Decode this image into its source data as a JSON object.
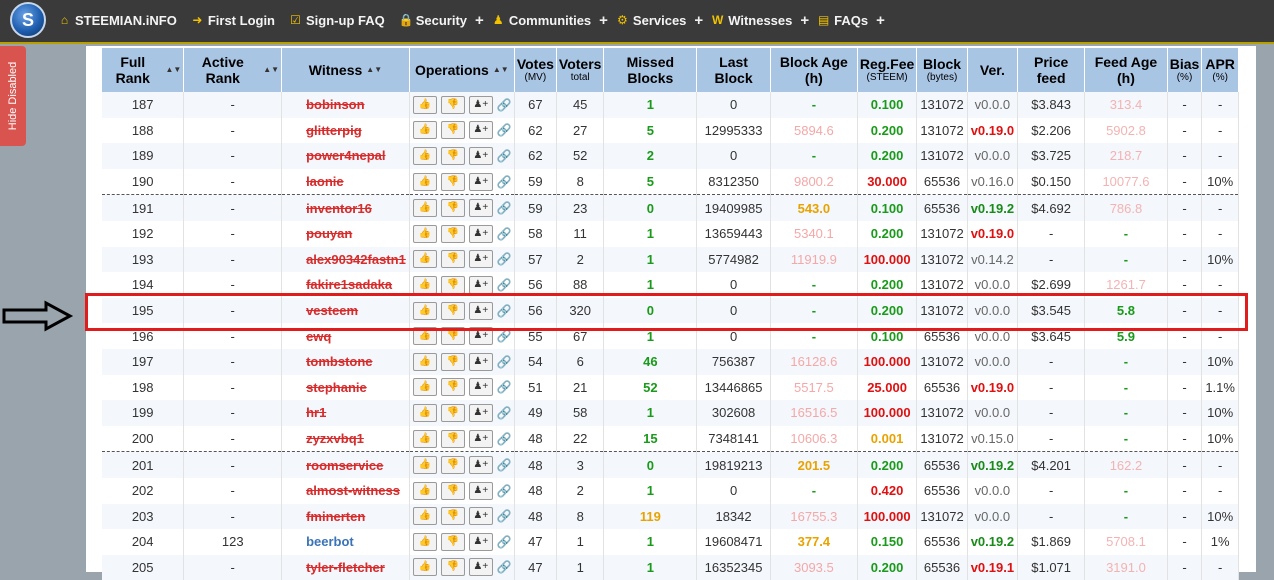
{
  "nav": {
    "brand": "STEEMIAN.iNFO",
    "items": [
      {
        "label": "First Login",
        "icon": "sign-in-icon",
        "plus": false
      },
      {
        "label": "Sign-up FAQ",
        "icon": "checkbox-icon",
        "plus": false
      },
      {
        "label": "Security",
        "icon": "lock-icon",
        "plus": true
      },
      {
        "label": "Communities",
        "icon": "users-icon",
        "plus": true
      },
      {
        "label": "Services",
        "icon": "cogs-icon",
        "plus": true
      },
      {
        "label": "Witnesses",
        "icon": "wordpress-icon",
        "plus": true
      },
      {
        "label": "FAQs",
        "icon": "document-icon",
        "plus": true
      }
    ]
  },
  "side_tab": {
    "label": "Hide Disabled"
  },
  "table": {
    "headers": [
      {
        "label": "Full Rank",
        "sub": ""
      },
      {
        "label": "Active Rank",
        "sub": ""
      },
      {
        "label": "Witness",
        "sub": ""
      },
      {
        "label": "Operations",
        "sub": ""
      },
      {
        "label": "Votes",
        "sub": "(MV)"
      },
      {
        "label": "Voters",
        "sub": "total"
      },
      {
        "label": "Missed Blocks",
        "sub": ""
      },
      {
        "label": "Last Block",
        "sub": ""
      },
      {
        "label": "Block Age (h)",
        "sub": ""
      },
      {
        "label": "Reg.Fee",
        "sub": "(STEEM)"
      },
      {
        "label": "Block",
        "sub": "(bytes)"
      },
      {
        "label": "Ver.",
        "sub": ""
      },
      {
        "label": "Price feed",
        "sub": ""
      },
      {
        "label": "Feed Age (h)",
        "sub": ""
      },
      {
        "label": "Bias",
        "sub": "(%)"
      },
      {
        "label": "APR",
        "sub": "(%)"
      }
    ],
    "rows": [
      {
        "rank": "187",
        "active": "-",
        "name": "bobinson",
        "link": "ok",
        "votes": "67",
        "voters": "45",
        "missed": "1",
        "mc": "g",
        "last": "0",
        "age": "-",
        "ac": "g",
        "fee": "0.100",
        "fc": "g",
        "block": "131072",
        "ver": "v0.0.0",
        "vc": "ver",
        "price": "$3.843",
        "feed": "313.4",
        "fdc": "pinkl",
        "bias": "-",
        "apr": "-",
        "group": false
      },
      {
        "rank": "188",
        "active": "-",
        "name": "glitterpig",
        "link": "ok",
        "votes": "62",
        "voters": "27",
        "missed": "5",
        "mc": "g",
        "last": "12995333",
        "age": "5894.6",
        "ac": "pink",
        "fee": "0.200",
        "fc": "g",
        "block": "131072",
        "ver": "v0.19.0",
        "vc": "verr",
        "price": "$2.206",
        "feed": "5902.8",
        "fdc": "pinkl",
        "bias": "-",
        "apr": "-",
        "group": false
      },
      {
        "rank": "189",
        "active": "-",
        "name": "power4nepal",
        "link": "ok",
        "votes": "62",
        "voters": "52",
        "missed": "2",
        "mc": "g",
        "last": "0",
        "age": "-",
        "ac": "g",
        "fee": "0.200",
        "fc": "g",
        "block": "131072",
        "ver": "v0.0.0",
        "vc": "ver",
        "price": "$3.725",
        "feed": "218.7",
        "fdc": "pinkl",
        "bias": "-",
        "apr": "-",
        "group": false
      },
      {
        "rank": "190",
        "active": "-",
        "name": "laonie",
        "link": "ok",
        "votes": "59",
        "voters": "8",
        "missed": "5",
        "mc": "g",
        "last": "8312350",
        "age": "9800.2",
        "ac": "pink",
        "fee": "30.000",
        "fc": "r",
        "block": "65536",
        "ver": "v0.16.0",
        "vc": "ver",
        "price": "$0.150",
        "feed": "10077.6",
        "fdc": "pinkl",
        "bias": "-",
        "apr": "10%",
        "group": false
      },
      {
        "rank": "191",
        "active": "-",
        "name": "inventor16",
        "link": "ok",
        "votes": "59",
        "voters": "23",
        "missed": "0",
        "mc": "g",
        "last": "19409985",
        "age": "543.0",
        "ac": "o",
        "fee": "0.100",
        "fc": "g",
        "block": "65536",
        "ver": "v0.19.2",
        "vc": "verg",
        "price": "$4.692",
        "feed": "786.8",
        "fdc": "pinkl",
        "bias": "-",
        "apr": "-",
        "group": true
      },
      {
        "rank": "192",
        "active": "-",
        "name": "pouyan",
        "link": "ok",
        "votes": "58",
        "voters": "11",
        "missed": "1",
        "mc": "g",
        "last": "13659443",
        "age": "5340.1",
        "ac": "pink",
        "fee": "0.200",
        "fc": "g",
        "block": "131072",
        "ver": "v0.19.0",
        "vc": "verr",
        "price": "-",
        "feed": "-",
        "fdc": "feedg",
        "bias": "-",
        "apr": "-",
        "group": false
      },
      {
        "rank": "193",
        "active": "-",
        "name": "alex90342fastn1",
        "link": "broken",
        "votes": "57",
        "voters": "2",
        "missed": "1",
        "mc": "g",
        "last": "5774982",
        "age": "11919.9",
        "ac": "pink",
        "fee": "100.000",
        "fc": "r",
        "block": "131072",
        "ver": "v0.14.2",
        "vc": "ver",
        "price": "-",
        "feed": "-",
        "fdc": "feedg",
        "bias": "-",
        "apr": "10%",
        "group": false
      },
      {
        "rank": "194",
        "active": "-",
        "name": "fakire1sadaka",
        "link": "ok",
        "votes": "56",
        "voters": "88",
        "missed": "1",
        "mc": "g",
        "last": "0",
        "age": "-",
        "ac": "g",
        "fee": "0.200",
        "fc": "g",
        "block": "131072",
        "ver": "v0.0.0",
        "vc": "ver",
        "price": "$2.699",
        "feed": "1261.7",
        "fdc": "pinkl",
        "bias": "-",
        "apr": "-",
        "group": false
      },
      {
        "rank": "195",
        "active": "-",
        "name": "vesteem",
        "link": "ok",
        "votes": "56",
        "voters": "320",
        "missed": "0",
        "mc": "g",
        "last": "0",
        "age": "-",
        "ac": "g",
        "fee": "0.200",
        "fc": "g",
        "block": "131072",
        "ver": "v0.0.0",
        "vc": "ver",
        "price": "$3.545",
        "feed": "5.8",
        "fdc": "feedg",
        "bias": "-",
        "apr": "-",
        "group": false
      },
      {
        "rank": "196",
        "active": "-",
        "name": "ewq",
        "link": "ok",
        "votes": "55",
        "voters": "67",
        "missed": "1",
        "mc": "g",
        "last": "0",
        "age": "-",
        "ac": "g",
        "fee": "0.100",
        "fc": "g",
        "block": "65536",
        "ver": "v0.0.0",
        "vc": "ver",
        "price": "$3.645",
        "feed": "5.9",
        "fdc": "feedg",
        "bias": "-",
        "apr": "-",
        "group": false
      },
      {
        "rank": "197",
        "active": "-",
        "name": "tombstone",
        "link": "gray",
        "votes": "54",
        "voters": "6",
        "missed": "46",
        "mc": "g",
        "last": "756387",
        "age": "16128.6",
        "ac": "pink",
        "fee": "100.000",
        "fc": "r",
        "block": "131072",
        "ver": "v0.0.0",
        "vc": "ver",
        "price": "-",
        "feed": "-",
        "fdc": "feedg",
        "bias": "-",
        "apr": "10%",
        "group": false
      },
      {
        "rank": "198",
        "active": "-",
        "name": "stephanie",
        "link": "ok",
        "votes": "51",
        "voters": "21",
        "missed": "52",
        "mc": "g",
        "last": "13446865",
        "age": "5517.5",
        "ac": "pink",
        "fee": "25.000",
        "fc": "r",
        "block": "65536",
        "ver": "v0.19.0",
        "vc": "verr",
        "price": "-",
        "feed": "-",
        "fdc": "feedg",
        "bias": "-",
        "apr": "1.1%",
        "group": false
      },
      {
        "rank": "199",
        "active": "-",
        "name": "hr1",
        "link": "gray",
        "votes": "49",
        "voters": "58",
        "missed": "1",
        "mc": "g",
        "last": "302608",
        "age": "16516.5",
        "ac": "pink",
        "fee": "100.000",
        "fc": "r",
        "block": "131072",
        "ver": "v0.0.0",
        "vc": "ver",
        "price": "-",
        "feed": "-",
        "fdc": "feedg",
        "bias": "-",
        "apr": "10%",
        "group": false
      },
      {
        "rank": "200",
        "active": "-",
        "name": "zyzxvbq1",
        "link": "gray",
        "votes": "48",
        "voters": "22",
        "missed": "15",
        "mc": "g",
        "last": "7348141",
        "age": "10606.3",
        "ac": "pink",
        "fee": "0.001",
        "fc": "o",
        "block": "131072",
        "ver": "v0.15.0",
        "vc": "ver",
        "price": "-",
        "feed": "-",
        "fdc": "feedg",
        "bias": "-",
        "apr": "10%",
        "group": false
      },
      {
        "rank": "201",
        "active": "-",
        "name": "roomservice",
        "link": "ok",
        "votes": "48",
        "voters": "3",
        "missed": "0",
        "mc": "g",
        "last": "19819213",
        "age": "201.5",
        "ac": "o",
        "fee": "0.200",
        "fc": "g",
        "block": "65536",
        "ver": "v0.19.2",
        "vc": "verg",
        "price": "$4.201",
        "feed": "162.2",
        "fdc": "pinkl",
        "bias": "-",
        "apr": "-",
        "group": true
      },
      {
        "rank": "202",
        "active": "-",
        "name": "almost-witness",
        "link": "ok",
        "votes": "48",
        "voters": "2",
        "missed": "1",
        "mc": "g",
        "last": "0",
        "age": "-",
        "ac": "g",
        "fee": "0.420",
        "fc": "r",
        "block": "65536",
        "ver": "v0.0.0",
        "vc": "ver",
        "price": "-",
        "feed": "-",
        "fdc": "feedg",
        "bias": "-",
        "apr": "-",
        "group": false
      },
      {
        "rank": "203",
        "active": "-",
        "name": "fminerten",
        "link": "gray",
        "votes": "48",
        "voters": "8",
        "missed": "119",
        "mc": "o",
        "last": "18342",
        "age": "16755.3",
        "ac": "pink",
        "fee": "100.000",
        "fc": "r",
        "block": "131072",
        "ver": "v0.0.0",
        "vc": "ver",
        "price": "-",
        "feed": "-",
        "fdc": "feedg",
        "bias": "-",
        "apr": "10%",
        "group": false
      },
      {
        "rank": "204",
        "active": "123",
        "name": "beerbot",
        "link": "broken",
        "votes": "47",
        "voters": "1",
        "missed": "1",
        "mc": "g",
        "last": "19608471",
        "age": "377.4",
        "ac": "o",
        "fee": "0.150",
        "fc": "g",
        "block": "65536",
        "ver": "v0.19.2",
        "vc": "verg",
        "price": "$1.869",
        "feed": "5708.1",
        "fdc": "pinkl",
        "bias": "-",
        "apr": "1%",
        "group": false,
        "active_name": true
      },
      {
        "rank": "205",
        "active": "-",
        "name": "tyler-fletcher",
        "link": "ok",
        "votes": "47",
        "voters": "1",
        "missed": "1",
        "mc": "g",
        "last": "16352345",
        "age": "3093.5",
        "ac": "pink",
        "fee": "0.200",
        "fc": "g",
        "block": "65536",
        "ver": "v0.19.1",
        "vc": "verr",
        "price": "$1.071",
        "feed": "3191.0",
        "fdc": "pinkl",
        "bias": "-",
        "apr": "-",
        "group": false
      }
    ]
  },
  "colors": {
    "highlight": "#e01c1c",
    "header_bg": "#a9c5e4",
    "nav_bg": "#3a3a3a"
  }
}
